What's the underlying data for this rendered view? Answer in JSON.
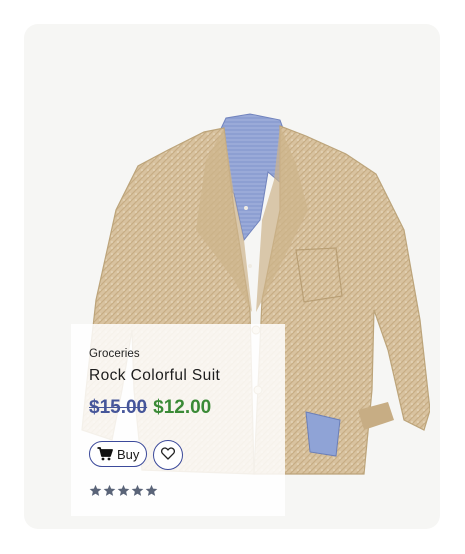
{
  "product": {
    "category": "Groceries",
    "name": "Rock Colorful Suit",
    "old_price": "$15.00",
    "new_price": "$12.00",
    "buy_label": "Buy",
    "rating": 5,
    "rating_max": 5,
    "image": "suit-jacket-photo"
  },
  "colors": {
    "card_background": "#f6f6f4",
    "old_price": "#46569a",
    "new_price": "#3a8a36",
    "button_border": "#3c4a9b",
    "star": "#5a6478"
  },
  "icons": {
    "buy": "cart-icon",
    "wishlist": "heart-icon",
    "rating": "star-icon"
  }
}
